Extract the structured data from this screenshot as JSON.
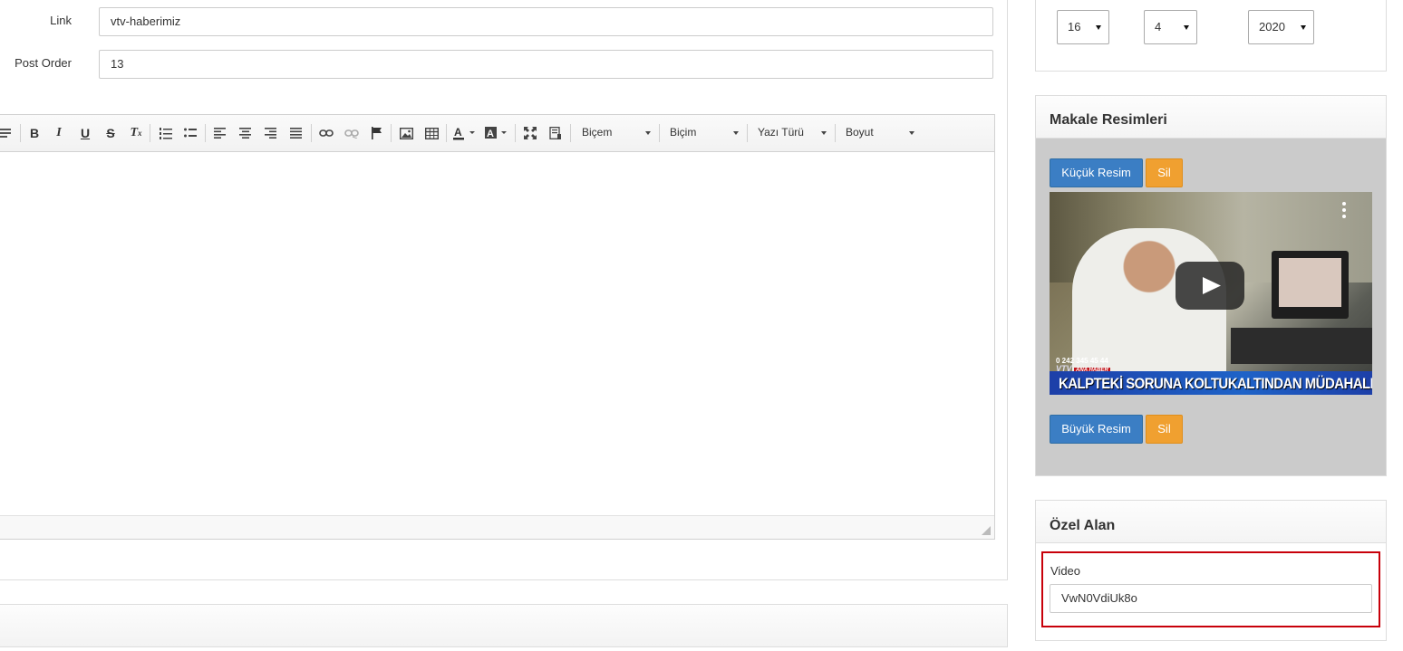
{
  "form": {
    "link_label": "Link",
    "link_value": "vtv-haberimiz",
    "post_order_label": "Post Order",
    "post_order_value": "13"
  },
  "editor": {
    "toolbar": {
      "style_combo": "Biçem",
      "format_combo": "Biçim",
      "font_combo": "Yazı Türü",
      "size_combo": "Boyut",
      "bold": "B",
      "italic": "I",
      "underline": "U",
      "strike": "S",
      "remove_format": "T"
    }
  },
  "date": {
    "day": "16",
    "month": "4",
    "year": "2020"
  },
  "images_box": {
    "title": "Makale Resimleri",
    "small_image_button": "Küçük Resim",
    "small_delete_button": "Sil",
    "large_image_button": "Büyük Resim",
    "large_delete_button": "Sil",
    "video": {
      "phone": "0 242 345 45 44",
      "channel": "VTV",
      "channel_sub": "ANA HABER",
      "headline": "KALPTEKİ SORUNA KOLTUKALTINDAN MÜDAHALE"
    }
  },
  "custom_box": {
    "title": "Özel Alan",
    "video_label": "Video",
    "video_value": "VwN0VdiUk8o"
  },
  "colors": {
    "primary_button": "#3b7ec4",
    "warning_button": "#f0a030",
    "highlight_border": "#c8000a",
    "image_panel_bg": "#cbcbcb"
  }
}
